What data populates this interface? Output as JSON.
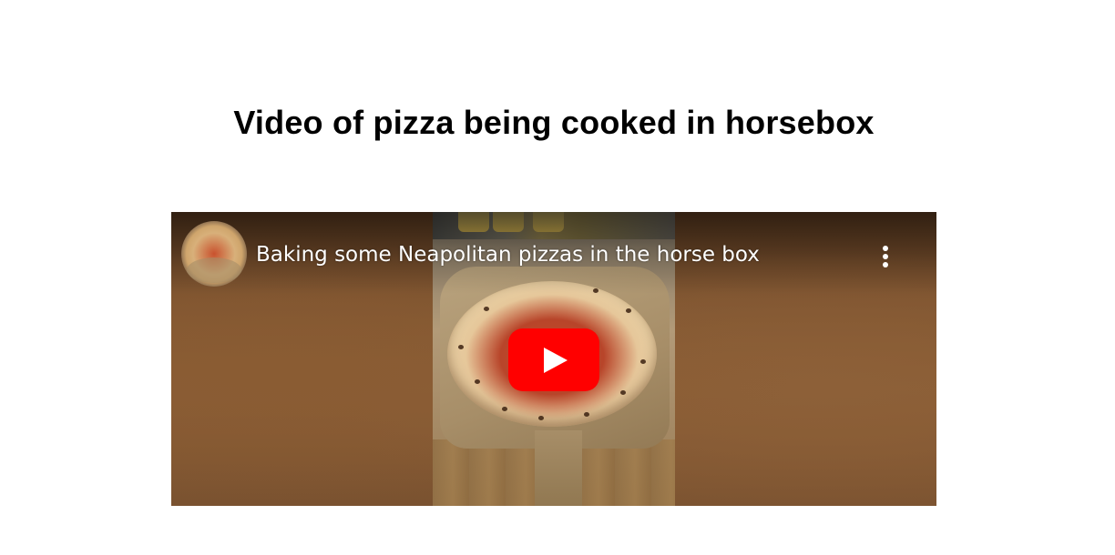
{
  "page": {
    "title": "Video of pizza being cooked in horsebox"
  },
  "video": {
    "title": "Baking some Neapolitan pizzas in the horse box",
    "channel_avatar_icon": "pizza-avatar",
    "more_icon": "vertical-ellipsis",
    "play_icon": "youtube-play",
    "play_button_color": "#ff0000"
  }
}
